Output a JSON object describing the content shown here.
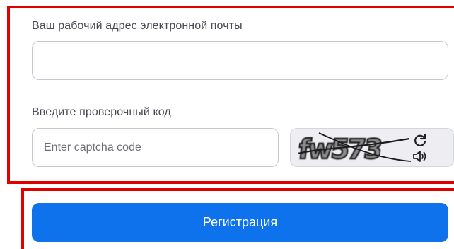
{
  "form": {
    "email_label": "Ваш рабочий адрес электронной почты",
    "email_value": "",
    "code_label": "Введите проверочный код",
    "captcha_placeholder": "Enter captcha code",
    "captcha_text": "fw573",
    "captcha_refresh_icon": "refresh-icon",
    "captcha_audio_icon": "audio-icon"
  },
  "register_button": {
    "label": "Регистрация",
    "color": "#0e72ed"
  },
  "highlight_color": "#e10000"
}
